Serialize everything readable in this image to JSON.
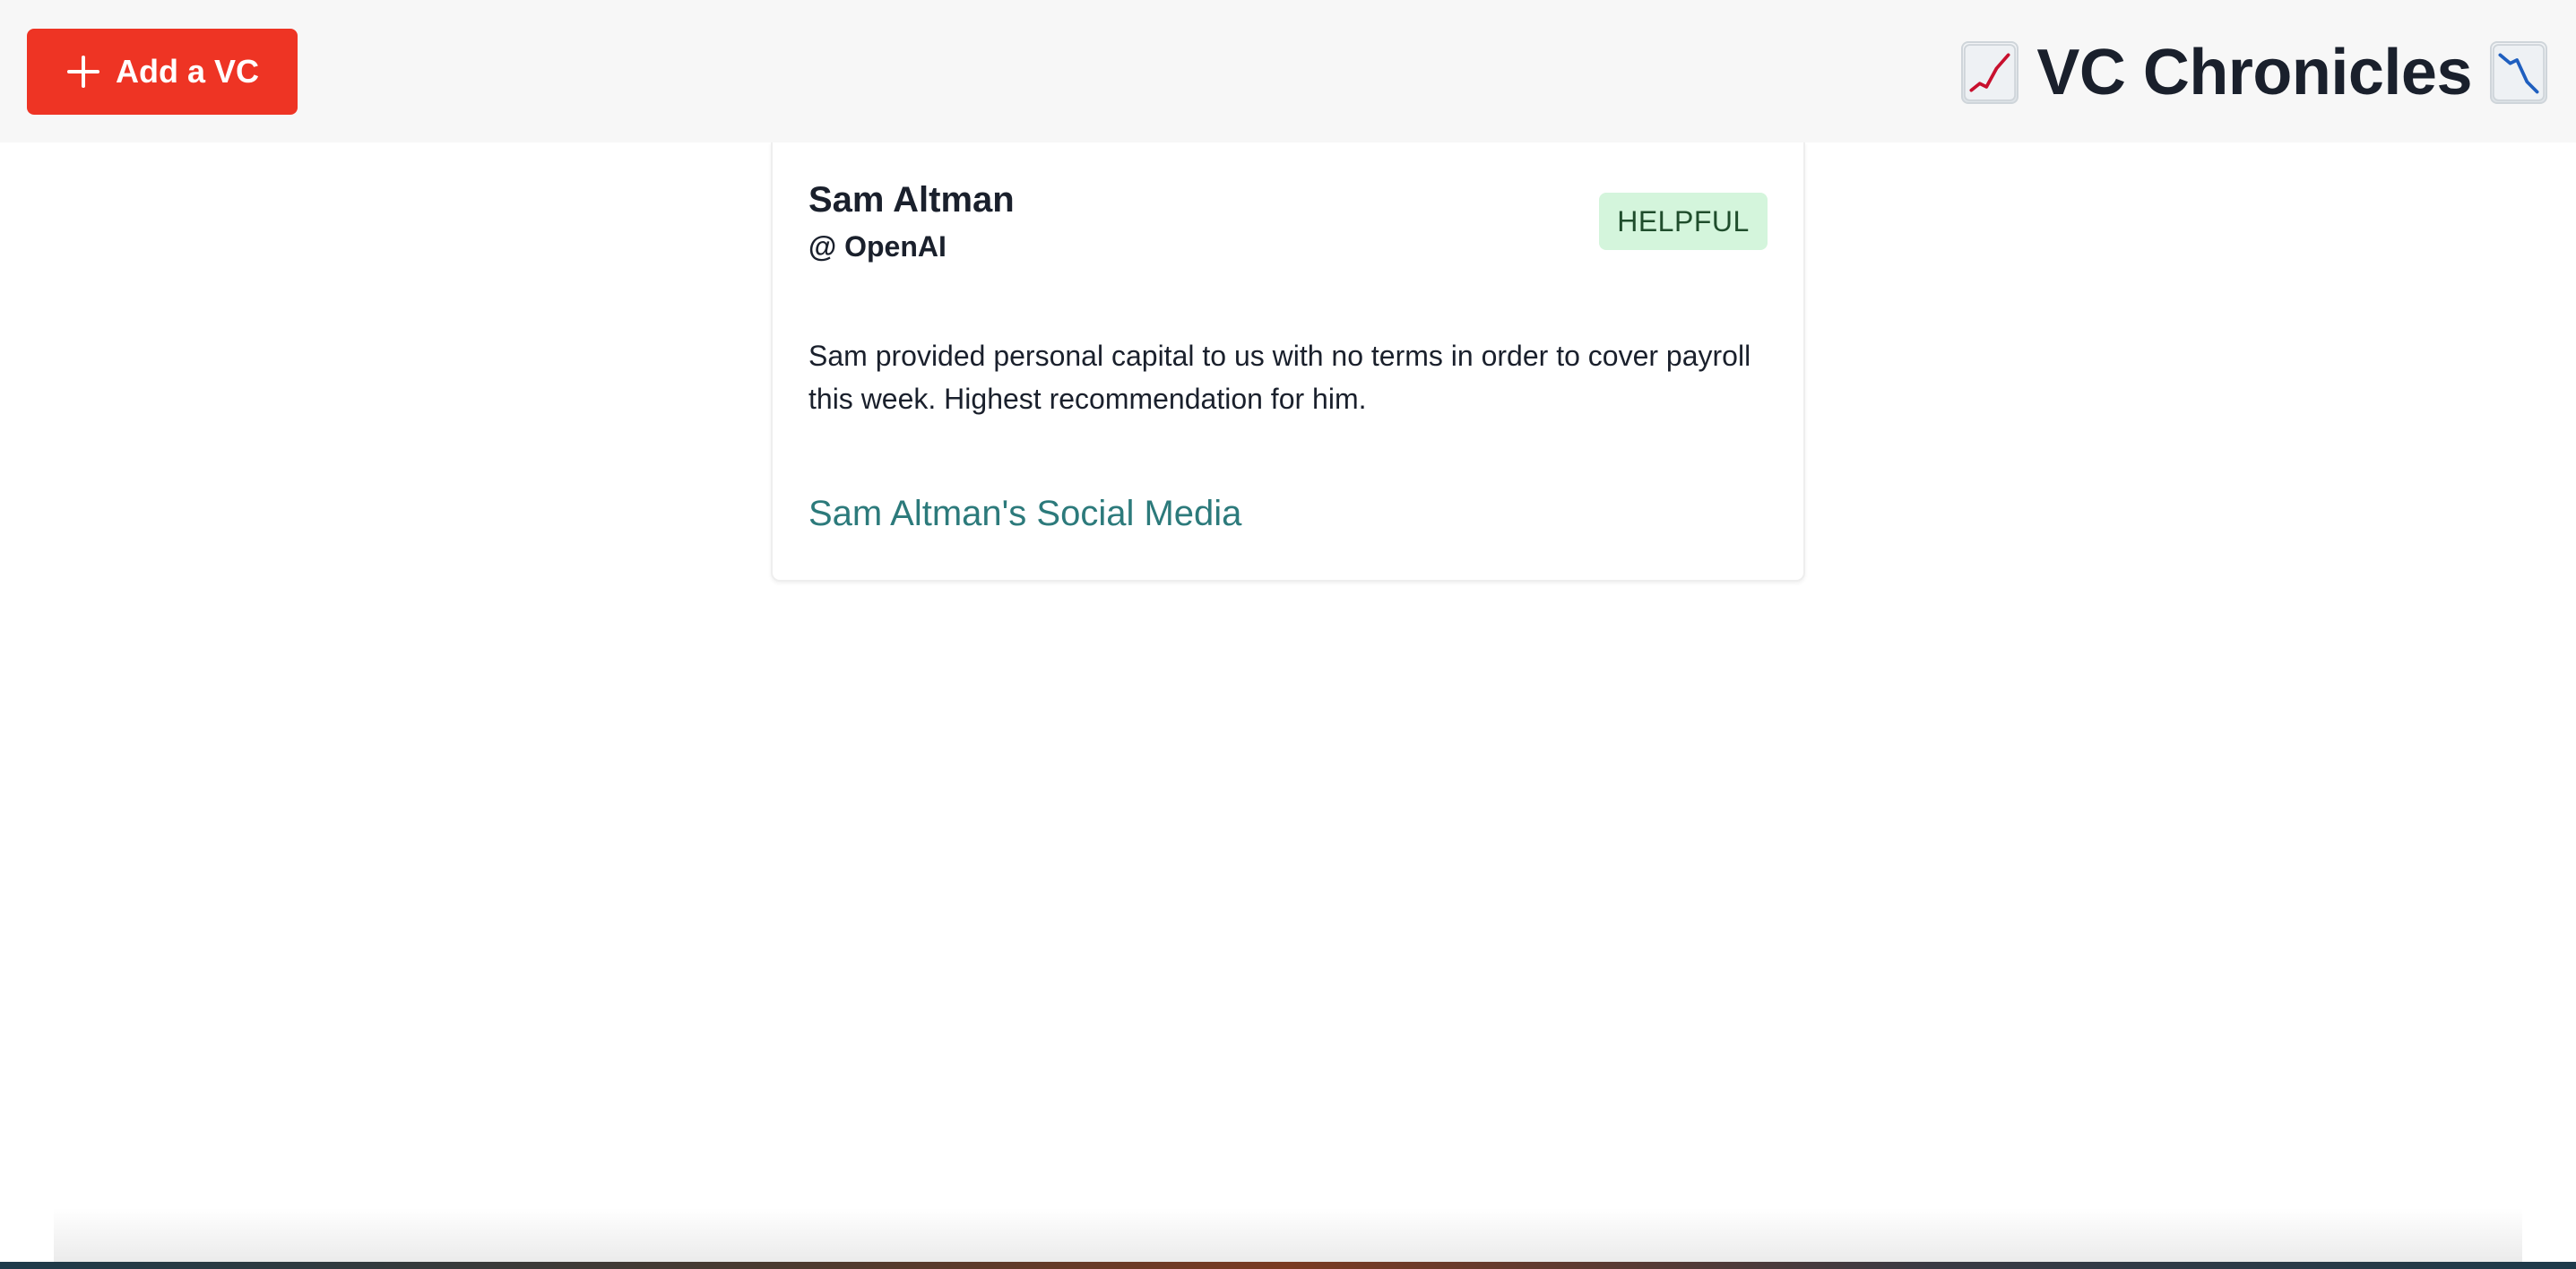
{
  "header": {
    "add_button_label": "Add a VC",
    "title": "VC Chronicles",
    "left_icon": "chart-increasing-icon",
    "right_icon": "chart-decreasing-icon",
    "colors": {
      "add_button": "#ee3424",
      "header_background": "#f7f7f7",
      "title_text": "#1a202c"
    }
  },
  "cards": [
    {
      "name": "Sam Altman",
      "firm": "@ OpenAI",
      "badge": "HELPFUL",
      "review": "Sam provided personal capital to us with no terms in order to cover payroll this week. Highest recommendation for him.",
      "social_link_label": "Sam Altman's Social Media",
      "colors": {
        "badge_background": "#d4f5dc",
        "badge_text": "#1f4d2c",
        "link": "#2c7a7b"
      }
    }
  ]
}
